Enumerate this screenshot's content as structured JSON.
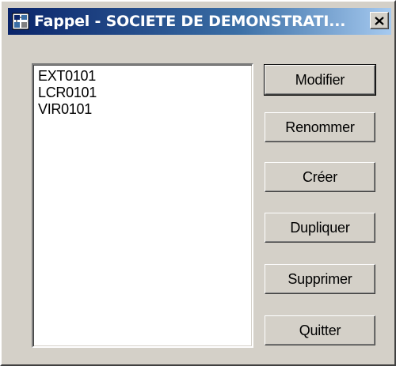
{
  "window": {
    "title": "Fappel - SOCIETE DE DEMONSTRATI...",
    "icon": "app-icon",
    "close_icon": "close-icon"
  },
  "list": {
    "items": [
      "EXT0101",
      "LCR0101",
      "VIR0101"
    ]
  },
  "buttons": {
    "modifier": "Modifier",
    "renommer": "Renommer",
    "creer": "Créer",
    "dupliquer": "Dupliquer",
    "supprimer": "Supprimer",
    "quitter": "Quitter"
  },
  "colors": {
    "face": "#d4d0c8",
    "title_start": "#0a246a",
    "title_end": "#a6caf0"
  }
}
